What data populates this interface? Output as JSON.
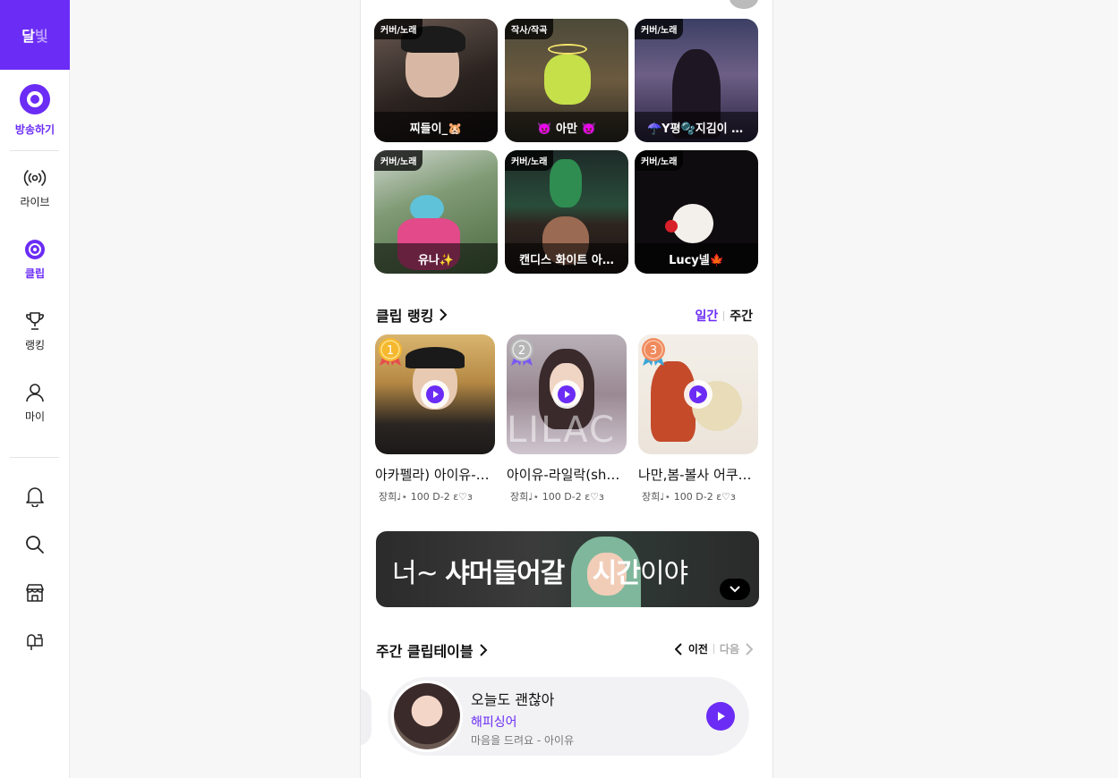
{
  "sidebar": {
    "logo": {
      "part1": "달",
      "part2": "빛"
    },
    "broadcast_label": "방송하기",
    "items": [
      {
        "label": "라이브",
        "icon": "broadcast-icon"
      },
      {
        "label": "클립",
        "icon": "clip-icon",
        "active": true
      },
      {
        "label": "랭킹",
        "icon": "trophy-icon"
      },
      {
        "label": "마이",
        "icon": "user-icon"
      }
    ],
    "bottom_icons": [
      "bell-icon",
      "search-icon",
      "store-icon",
      "mailbox-icon"
    ]
  },
  "grid": {
    "items": [
      {
        "category": "커버/노래",
        "name": "찌들이_🐹"
      },
      {
        "category": "작사/작곡",
        "name": "👿 아만 👿"
      },
      {
        "category": "커버/노래",
        "name": "☂️Y평🫧지김이 …"
      },
      {
        "category": "커버/노래",
        "name": "유나✨"
      },
      {
        "category": "커버/노래",
        "name": "캔디스 화이트 아…"
      },
      {
        "category": "커버/노래",
        "name": "Lucy넬🍁"
      }
    ]
  },
  "ranking": {
    "title": "클립 랭킹",
    "tab_daily": "일간",
    "tab_weekly": "주간",
    "items": [
      {
        "rank": "1",
        "title": "아카펠라) 아이유-…",
        "meta": "장희♩⋆ 100 D-2  ε♡з"
      },
      {
        "rank": "2",
        "title": "아이유-라일락(sh…",
        "meta": "장희♩⋆ 100 D-2  ε♡з"
      },
      {
        "rank": "3",
        "title": "나만,봄-볼사 어쿠…",
        "meta": "장희♩⋆ 100 D-2  ε♡з"
      }
    ]
  },
  "banner": {
    "text_a": "너~ ",
    "text_b": "샤머들어갈 ",
    "text_c": "시간",
    "text_d": "이야"
  },
  "weekly_table": {
    "title": "주간 클립테이블",
    "prev": "이전",
    "next": "다음",
    "card": {
      "title": "오늘도 괜찮아",
      "user": "해피싱어",
      "song": "마음을 드려요 - 아이유"
    }
  },
  "colors": {
    "accent": "#6b2cf5",
    "accent_text": "#6b2cf5"
  }
}
